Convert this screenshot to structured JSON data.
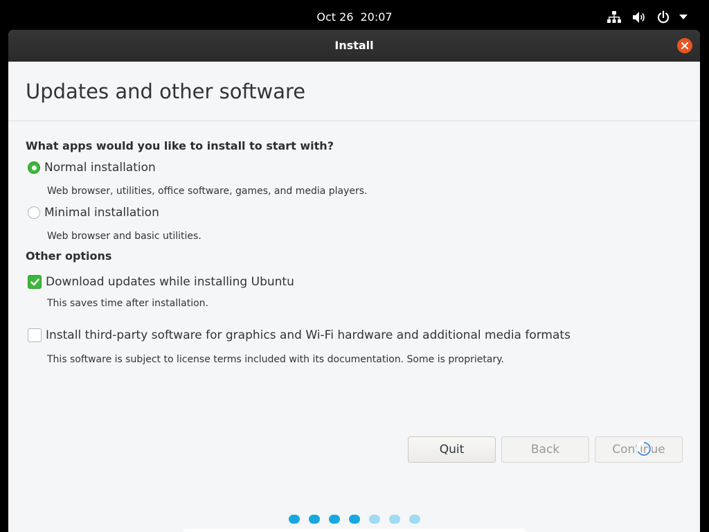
{
  "topbar": {
    "date": "Oct 26",
    "time": "20:07",
    "icons": [
      "network-icon",
      "volume-icon",
      "power-icon",
      "menu-arrow-icon"
    ]
  },
  "window": {
    "title": "Install",
    "close_icon": "close-icon"
  },
  "page": {
    "title": "Updates and other software",
    "apps_question": "What apps would you like to install to start with?",
    "installation_options": [
      {
        "label": "Normal installation",
        "description": "Web browser, utilities, office software, games, and media players.",
        "selected": true
      },
      {
        "label": "Minimal installation",
        "description": "Web browser and basic utilities.",
        "selected": false
      }
    ],
    "other_heading": "Other options",
    "other_options": [
      {
        "label": "Download updates while installing Ubuntu",
        "description": "This saves time after installation.",
        "checked": true
      },
      {
        "label": "Install third-party software for graphics and Wi-Fi hardware and additional media formats",
        "description": "This software is subject to license terms included with its documentation. Some is proprietary.",
        "checked": false
      }
    ]
  },
  "buttons": {
    "quit": "Quit",
    "back": "Back",
    "continue": "Continue"
  },
  "progress": {
    "total_steps": 7,
    "completed_steps": 4
  },
  "colors": {
    "accent_green": "#3cb63c",
    "close_orange": "#e95420",
    "dot_done": "#17a8e0",
    "dot_todo": "#9ddcf3"
  }
}
